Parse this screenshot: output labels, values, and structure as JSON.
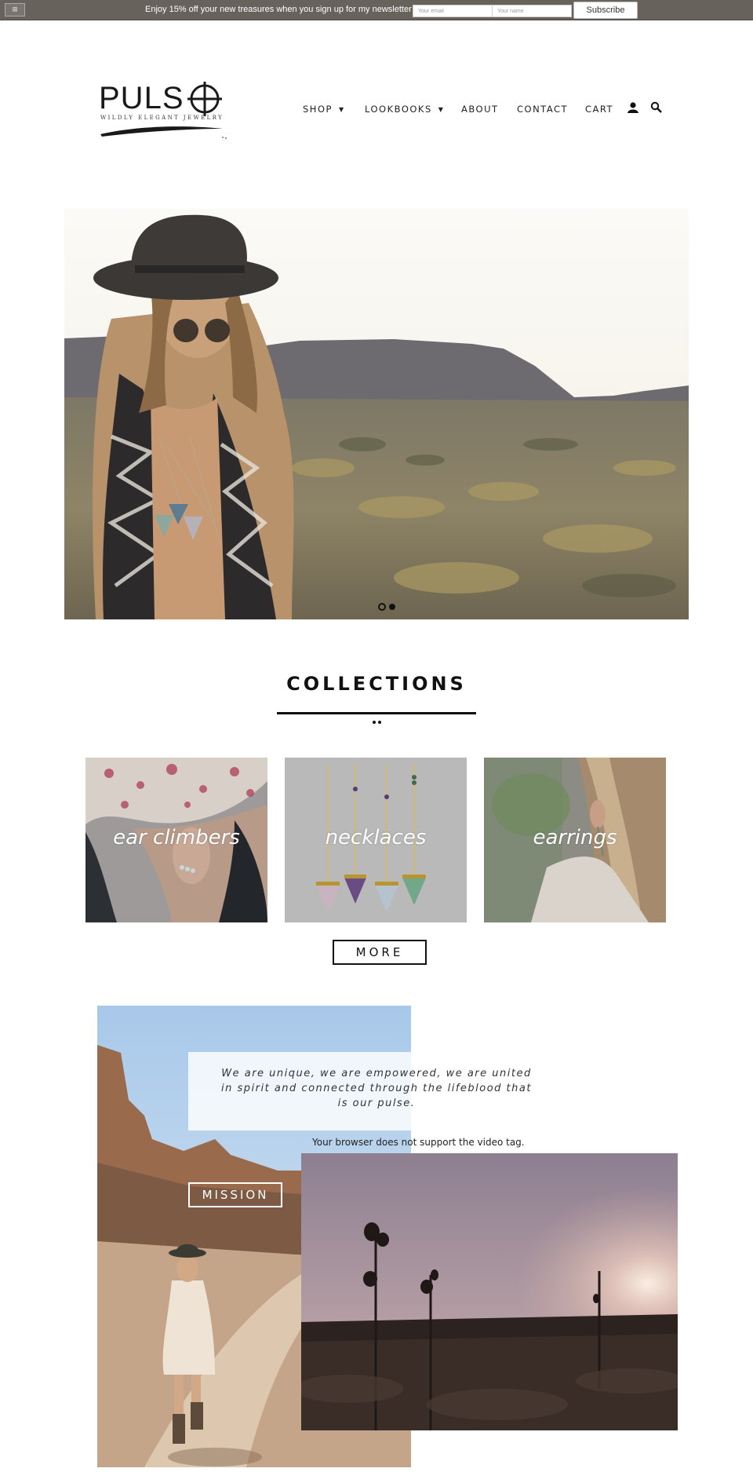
{
  "newsletter": {
    "close_icon": "close-icon",
    "promo_text": "Enjoy 15% off your new treasures when you sign up for my newsletter",
    "email_placeholder": "Your email",
    "name_placeholder": "Your name",
    "subscribe_label": "Subscribe"
  },
  "header": {
    "logo_word": "PULS",
    "logo_tagline": "WILDLY ELEGANT JEWELRY",
    "nav": [
      {
        "label": "SHOP",
        "has_dropdown": true
      },
      {
        "label": "LOOKBOOKS",
        "has_dropdown": true
      },
      {
        "label": "ABOUT",
        "has_dropdown": false
      },
      {
        "label": "CONTACT",
        "has_dropdown": false
      },
      {
        "label": "CART",
        "has_dropdown": false
      }
    ],
    "icons": [
      "account-icon",
      "search-icon"
    ]
  },
  "hero": {
    "slide_count": 2,
    "active_slide": 1
  },
  "collections": {
    "title": "COLLECTIONS",
    "tiles": [
      {
        "label": "ear climbers"
      },
      {
        "label": "necklaces"
      },
      {
        "label": "earrings"
      }
    ],
    "more_label": "MORE"
  },
  "mission": {
    "quote": "We are unique, we are empowered, we are united in spirit and connected through the lifeblood that is our pulse.",
    "button_label": "MISSION",
    "video_fallback": "Your browser does not support the video tag."
  },
  "colors": {
    "topbar": "#68625d",
    "text": "#111111",
    "white": "#ffffff"
  }
}
